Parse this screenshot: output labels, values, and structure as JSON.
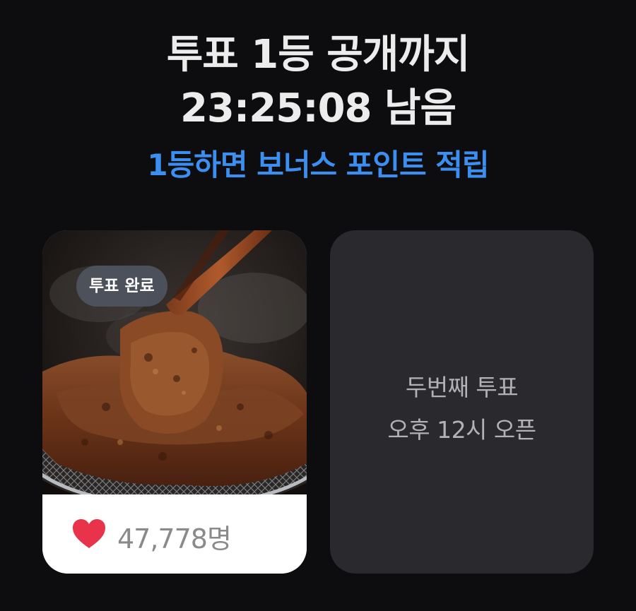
{
  "header": {
    "countdown_line1": "투표 1등 공개까지",
    "countdown_line2": "23:25:08 남음",
    "bonus_text": "1등하면 보너스 포인트 적립"
  },
  "cards": [
    {
      "badge": "투표 완료",
      "vote_count": "47,778명",
      "image_icon": "grilled-meat-photo",
      "like_icon": "heart-icon"
    },
    {
      "line1": "두번째 투표",
      "line2": "오후 12시 오픈"
    }
  ],
  "colors": {
    "background": "#0d0d0f",
    "accent_blue": "#3b8ff0",
    "heart_red": "#e8334a",
    "locked_card": "#2a2a2e"
  }
}
